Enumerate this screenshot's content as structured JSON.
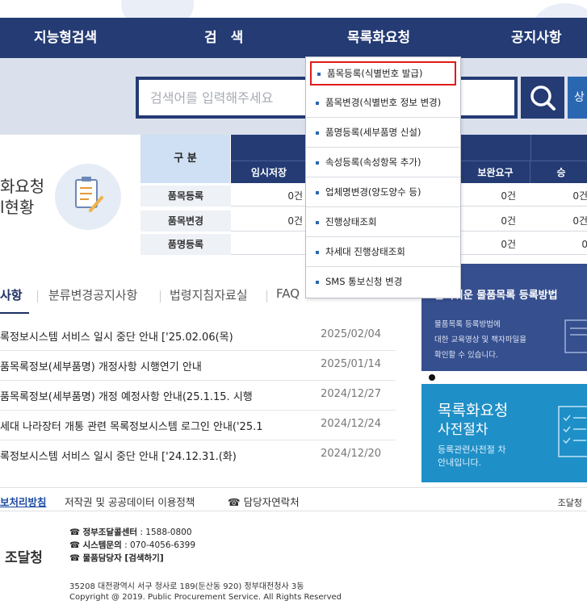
{
  "nav": {
    "items": [
      "지능형검색",
      "검　색",
      "목록화요청",
      "공지사항"
    ]
  },
  "search": {
    "placeholder": "검색어를 입력해주세요",
    "button2_label": "상"
  },
  "dropdown": {
    "items": [
      "품목등록(식별번호 발급)",
      "품목변경(식별번호 정보 변경)",
      "품명등록(세부품명 신설)",
      "속성등록(속성항목 추가)",
      "업체명변경(양도양수 등)",
      "진행상태조회",
      "차세대 진행상태조회",
      "SMS 통보신청 변경"
    ]
  },
  "status": {
    "title_line1": "화요청",
    "title_line2": "l현황",
    "gubun": "구 분",
    "col_temp": "임시저장",
    "col_fix": "보완요구",
    "col_appr": "승",
    "rows": [
      {
        "label": "품목등록",
        "v1": "0건",
        "v2": "0건",
        "v3": "0건"
      },
      {
        "label": "품목변경",
        "v1": "0건",
        "v2": "0건",
        "v3": "0건"
      },
      {
        "label": "품명등록",
        "v1": "",
        "v2": "0건",
        "v3": "0"
      }
    ]
  },
  "tabs": [
    "사항",
    "분류변경공지사항",
    "법령지침자료실",
    "FAQ"
  ],
  "notices": [
    {
      "title": "록정보시스템 서비스 일시 중단 안내 ['25.02.06(목)",
      "date": "2025/02/04"
    },
    {
      "title": "품목록정보(세부품명) 개정사항 시행연기 안내",
      "date": "2025/01/14"
    },
    {
      "title": "품목록정보(세부품명) 개정 예정사항 안내(25.1.15. 시행",
      "date": "2024/12/27"
    },
    {
      "title": "세대 나라장터 개통 관련 목록정보시스템 로그인 안내('25.1",
      "date": "2024/12/24"
    },
    {
      "title": "록정보시스템 서비스 일시 중단 안내 ['24.12.31.(화)",
      "date": "2024/12/20"
    }
  ],
  "banner1": {
    "heading": "알기쉬운 물품목록 등록방법",
    "text1": "물품목록 등록방법에",
    "text2": "대한 교육영상 및 책자파일을",
    "text3": "확인할 수 있습니다."
  },
  "banner2": {
    "heading1": "목록화요청",
    "heading2": "사전절차",
    "text1": "등록관련사전절 차",
    "text2": "안내입니다."
  },
  "footer": {
    "link1": "보처리방침",
    "link2": "저작권 및 공공데이터 이용정책",
    "link3": "담당자연락처",
    "right": "조달청",
    "logo": "조달청",
    "contact1_label": "정부조달콜센터",
    "contact1_value": " : 1588-0800",
    "contact2_label": "시스템문의",
    "contact2_value": " : 070-4056-6399",
    "contact3_label": "물품담당자 [검색하기]",
    "address": "35208 대전광역시 서구 청사로 189(둔산동 920) 정부대전청사 3동",
    "copyright": "Copyright @ 2019. Public Procurement Service. All Rights Reserved"
  },
  "colors": {
    "nav": "#243b74",
    "accent": "#2a67b1",
    "highlight": "#e01b1b",
    "banner2": "#1f8fc7"
  }
}
